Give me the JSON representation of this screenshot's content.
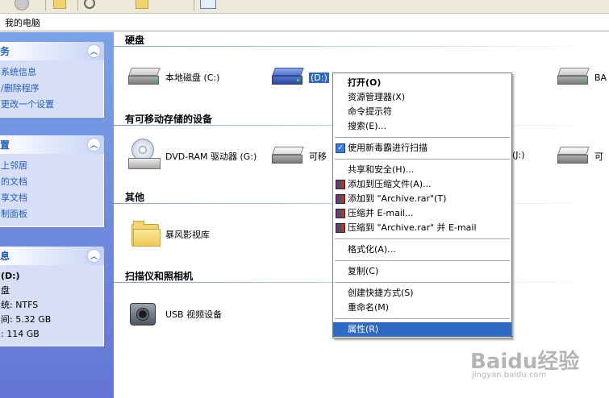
{
  "toolbar": {
    "btn1": "",
    "btn2": "",
    "btn3": ""
  },
  "address": {
    "path": "我的电脑"
  },
  "sidebar": {
    "tasks": {
      "title": "务",
      "links": [
        "系统信息",
        "/删除程序",
        "更改一个设置"
      ]
    },
    "places": {
      "title": "置",
      "links": [
        "上邻居",
        "的文档",
        "享文档",
        "制面板"
      ]
    },
    "details": {
      "title": "息",
      "lines": [
        "(D:)",
        "盘",
        "统: NTFS",
        "间: 5.32 GB",
        ": 114 GB"
      ]
    }
  },
  "groups": {
    "hard_disks": {
      "title": "硬盘",
      "items": [
        "本地磁盘 (C:)",
        "(D:)",
        "",
        "BA"
      ]
    },
    "removable": {
      "title": "有可移动存储的设备",
      "items": [
        "DVD-RAM 驱动器 (G:)",
        "可移",
        "(J:)",
        "可"
      ]
    },
    "other": {
      "title": "其他",
      "items": [
        "暴风影视库"
      ]
    },
    "scanners": {
      "title": "扫描仪和照相机",
      "items": [
        "USB 视频设备"
      ]
    }
  },
  "context_menu": {
    "items": [
      {
        "label": "打开(O)",
        "bold": true
      },
      {
        "label": "资源管理器(X)"
      },
      {
        "label": "命令提示符"
      },
      {
        "label": "搜索(E)..."
      },
      {
        "sep": true
      },
      {
        "label": "使用新毒霸进行扫描",
        "icon": "scan-icon"
      },
      {
        "sep": true
      },
      {
        "label": "共享和安全(H)..."
      },
      {
        "label": "添加到压缩文件(A)...",
        "icon": "winrar-icon"
      },
      {
        "label": "添加到 \"Archive.rar\"(T)",
        "icon": "winrar-icon"
      },
      {
        "label": "压缩并 E-mail...",
        "icon": "winrar-icon"
      },
      {
        "label": "压缩到 \"Archive.rar\" 并 E-mail",
        "icon": "winrar-icon"
      },
      {
        "sep": true
      },
      {
        "label": "格式化(A)..."
      },
      {
        "sep": true
      },
      {
        "label": "复制(C)"
      },
      {
        "sep": true
      },
      {
        "label": "创建快捷方式(S)"
      },
      {
        "label": "重命名(M)"
      },
      {
        "sep": true
      },
      {
        "label": "属性(R)",
        "highlighted": true
      }
    ]
  },
  "watermark": {
    "brand": "Baidu经验",
    "url": "jingyan.baidu.com"
  },
  "colors": {
    "highlight": "#316ac5",
    "sidebar_top": "#7ba2e7",
    "sidebar_bottom": "#6375d6"
  }
}
